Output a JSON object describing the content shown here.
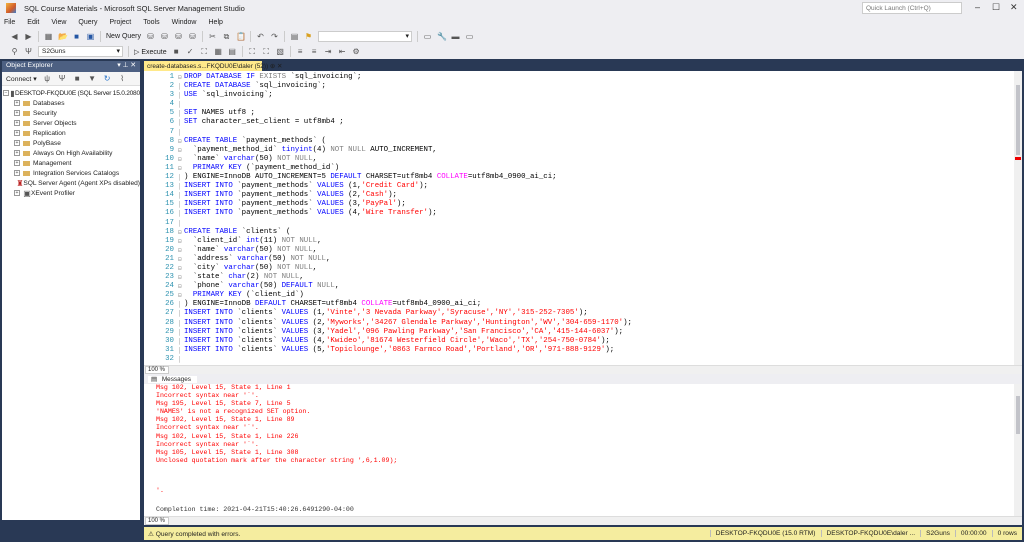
{
  "window": {
    "title": "SQL Course Materials - Microsoft SQL Server Management Studio",
    "quick_launch_placeholder": "Quick Launch (Ctrl+Q)"
  },
  "menu": [
    "File",
    "Edit",
    "View",
    "Query",
    "Project",
    "Tools",
    "Window",
    "Help"
  ],
  "toolbar": {
    "new_query": "New Query",
    "database": "S2Guns",
    "execute": "Execute"
  },
  "object_explorer": {
    "title": "Object Explorer",
    "connect": "Connect",
    "server": "DESKTOP-FKQDU0E (SQL Server 15.0.2080",
    "nodes": [
      "Databases",
      "Security",
      "Server Objects",
      "Replication",
      "PolyBase",
      "Always On High Availability",
      "Management",
      "Integration Services Catalogs",
      "SQL Server Agent (Agent XPs disabled)",
      "XEvent Profiler"
    ]
  },
  "editor": {
    "tab": "create-databases.s...FKQDU0E\\daler (52))",
    "zoom": "100 %",
    "lines": [
      [
        [
          "k",
          "DROP DATABASE IF "
        ],
        [
          "g",
          "EXISTS"
        ],
        [
          "t",
          " `sql_invoicing`;"
        ]
      ],
      [
        [
          "k",
          "CREATE DATABASE "
        ],
        [
          "t",
          "`sql_invoicing`;"
        ]
      ],
      [
        [
          "k",
          "USE "
        ],
        [
          "t",
          "`sql_invoicing`;"
        ]
      ],
      [],
      [
        [
          "k",
          "SET "
        ],
        [
          "t",
          "NAMES utf8 ;"
        ]
      ],
      [
        [
          "k",
          "SET "
        ],
        [
          "t",
          "character_set_client = utf8mb4 ;"
        ]
      ],
      [],
      [
        [
          "k",
          "CREATE TABLE "
        ],
        [
          "t",
          "`payment_methods` ("
        ]
      ],
      [
        [
          "t",
          "  `payment_method_id` "
        ],
        [
          "k",
          "tinyint"
        ],
        [
          "t",
          "(4) "
        ],
        [
          "g",
          "NOT NULL"
        ],
        [
          "t",
          " AUTO_INCREMENT,"
        ]
      ],
      [
        [
          "t",
          "  `name` "
        ],
        [
          "k",
          "varchar"
        ],
        [
          "t",
          "(50) "
        ],
        [
          "g",
          "NOT NULL"
        ],
        [
          "t",
          ","
        ]
      ],
      [
        [
          "k",
          "  PRIMARY KEY "
        ],
        [
          "t",
          "(`payment_method_id`)"
        ]
      ],
      [
        [
          "t",
          ") ENGINE=InnoDB AUTO_INCREMENT=5 "
        ],
        [
          "k",
          "DEFAULT "
        ],
        [
          "t",
          "CHARSET=utf8mb4 "
        ],
        [
          "m",
          "COLLATE"
        ],
        [
          "t",
          "=utf8mb4_0900_ai_ci;"
        ]
      ],
      [
        [
          "k",
          "INSERT INTO "
        ],
        [
          "t",
          "`payment_methods` "
        ],
        [
          "k",
          "VALUES "
        ],
        [
          "t",
          "(1,"
        ],
        [
          "s",
          "'Credit Card'"
        ],
        [
          "t",
          ");"
        ]
      ],
      [
        [
          "k",
          "INSERT INTO "
        ],
        [
          "t",
          "`payment_methods` "
        ],
        [
          "k",
          "VALUES "
        ],
        [
          "t",
          "(2,"
        ],
        [
          "s",
          "'Cash'"
        ],
        [
          "t",
          ");"
        ]
      ],
      [
        [
          "k",
          "INSERT INTO "
        ],
        [
          "t",
          "`payment_methods` "
        ],
        [
          "k",
          "VALUES "
        ],
        [
          "t",
          "(3,"
        ],
        [
          "s",
          "'PayPal'"
        ],
        [
          "t",
          ");"
        ]
      ],
      [
        [
          "k",
          "INSERT INTO "
        ],
        [
          "t",
          "`payment_methods` "
        ],
        [
          "k",
          "VALUES "
        ],
        [
          "t",
          "(4,"
        ],
        [
          "s",
          "'Wire Transfer'"
        ],
        [
          "t",
          ");"
        ]
      ],
      [],
      [
        [
          "k",
          "CREATE TABLE "
        ],
        [
          "t",
          "`clients` ("
        ]
      ],
      [
        [
          "t",
          "  `client_id` "
        ],
        [
          "k",
          "int"
        ],
        [
          "t",
          "(11) "
        ],
        [
          "g",
          "NOT NULL"
        ],
        [
          "t",
          ","
        ]
      ],
      [
        [
          "t",
          "  `name` "
        ],
        [
          "k",
          "varchar"
        ],
        [
          "t",
          "(50) "
        ],
        [
          "g",
          "NOT NULL"
        ],
        [
          "t",
          ","
        ]
      ],
      [
        [
          "t",
          "  `address` "
        ],
        [
          "k",
          "varchar"
        ],
        [
          "t",
          "(50) "
        ],
        [
          "g",
          "NOT NULL"
        ],
        [
          "t",
          ","
        ]
      ],
      [
        [
          "t",
          "  `city` "
        ],
        [
          "k",
          "varchar"
        ],
        [
          "t",
          "(50) "
        ],
        [
          "g",
          "NOT NULL"
        ],
        [
          "t",
          ","
        ]
      ],
      [
        [
          "t",
          "  `state` "
        ],
        [
          "k",
          "char"
        ],
        [
          "t",
          "(2) "
        ],
        [
          "g",
          "NOT NULL"
        ],
        [
          "t",
          ","
        ]
      ],
      [
        [
          "t",
          "  `phone` "
        ],
        [
          "k",
          "varchar"
        ],
        [
          "t",
          "(50) "
        ],
        [
          "k",
          "DEFAULT "
        ],
        [
          "g",
          "NULL"
        ],
        [
          "t",
          ","
        ]
      ],
      [
        [
          "k",
          "  PRIMARY KEY "
        ],
        [
          "t",
          "(`client_id`)"
        ]
      ],
      [
        [
          "t",
          ") ENGINE=InnoDB "
        ],
        [
          "k",
          "DEFAULT "
        ],
        [
          "t",
          "CHARSET=utf8mb4 "
        ],
        [
          "m",
          "COLLATE"
        ],
        [
          "t",
          "=utf8mb4_0900_ai_ci;"
        ]
      ],
      [
        [
          "k",
          "INSERT INTO "
        ],
        [
          "t",
          "`clients` "
        ],
        [
          "k",
          "VALUES "
        ],
        [
          "t",
          "(1,"
        ],
        [
          "s",
          "'Vinte','3 Nevada Parkway','Syracuse','NY','315-252-7305'"
        ],
        [
          "t",
          ");"
        ]
      ],
      [
        [
          "k",
          "INSERT INTO "
        ],
        [
          "t",
          "`clients` "
        ],
        [
          "k",
          "VALUES "
        ],
        [
          "t",
          "(2,"
        ],
        [
          "s",
          "'Myworks','34267 Glendale Parkway','Huntington','WV','304-659-1170'"
        ],
        [
          "t",
          ");"
        ]
      ],
      [
        [
          "k",
          "INSERT INTO "
        ],
        [
          "t",
          "`clients` "
        ],
        [
          "k",
          "VALUES "
        ],
        [
          "t",
          "(3,"
        ],
        [
          "s",
          "'Yadel','096 Pawling Parkway','San Francisco','CA','415-144-6037'"
        ],
        [
          "t",
          ");"
        ]
      ],
      [
        [
          "k",
          "INSERT INTO "
        ],
        [
          "t",
          "`clients` "
        ],
        [
          "k",
          "VALUES "
        ],
        [
          "t",
          "(4,"
        ],
        [
          "s",
          "'Kwideo','81674 Westerfield Circle','Waco','TX','254-750-0784'"
        ],
        [
          "t",
          ");"
        ]
      ],
      [
        [
          "k",
          "INSERT INTO "
        ],
        [
          "t",
          "`clients` "
        ],
        [
          "k",
          "VALUES "
        ],
        [
          "t",
          "(5,"
        ],
        [
          "s",
          "'Topiclounge','0863 Farmco Road','Portland','OR','971-888-9129'"
        ],
        [
          "t",
          ");"
        ]
      ],
      []
    ]
  },
  "messages": {
    "tab": "Messages",
    "errors": [
      "Msg 102, Level 15, State 1, Line 1",
      "Incorrect syntax near '`'.",
      "Msg 195, Level 15, State 7, Line 5",
      "'NAMES' is not a recognized SET option.",
      "Msg 102, Level 15, State 1, Line 89",
      "Incorrect syntax near '`'.",
      "Msg 102, Level 15, State 1, Line 226",
      "Incorrect syntax near '`'.",
      "Msg 105, Level 15, State 1, Line 308",
      "Unclosed quotation mark after the character string ',6,1.09);"
    ],
    "tail": "'.",
    "completion": "Completion time: 2021-04-21T15:40:26.6491290-04:00",
    "zoom": "100 %"
  },
  "status": {
    "message": "Query completed with errors.",
    "server": "DESKTOP-FKQDU0E (15.0 RTM)",
    "user": "DESKTOP-FKQDU0E\\daler ...",
    "database": "S2Guns",
    "time": "00:00:00",
    "rows": "0 rows"
  }
}
